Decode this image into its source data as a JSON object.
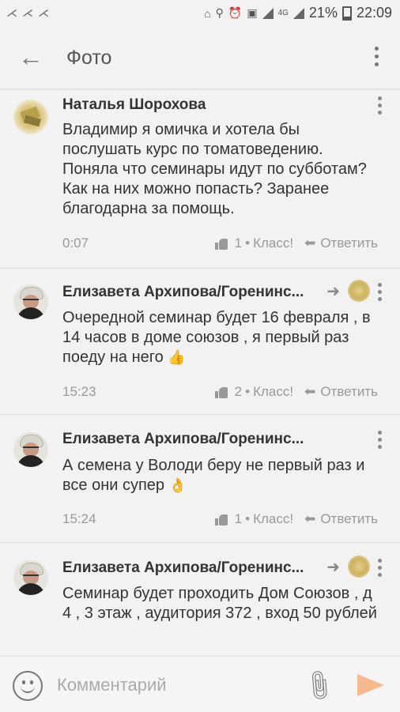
{
  "status_bar": {
    "battery": "21%",
    "time": "22:09",
    "network": "4G"
  },
  "app_bar": {
    "title": "Фото"
  },
  "comments": [
    {
      "author": "Наталья Шорохова",
      "text": "Владимир я омичка и хотела бы послушать курс по томатоведению. Поняла что семинары идут по субботам? Как на них можно попасть? Заранее благодарна за помощь.",
      "time": "0:07",
      "likes": "1",
      "like_label": "Класс!",
      "reply_label": "Ответить",
      "is_reply": false
    },
    {
      "author": "Елизавета Архипова/Горенинс...",
      "text": "Очередной семинар будет 16 февраля , в 14 часов в доме союзов , я первый раз поеду на него",
      "emoji": "👍",
      "time": "15:23",
      "likes": "2",
      "like_label": "Класс!",
      "reply_label": "Ответить",
      "is_reply": true
    },
    {
      "author": "Елизавета Архипова/Горенинс...",
      "text": "А семена у Володи беру не первый раз и все они супер",
      "emoji": "👌",
      "time": "15:24",
      "likes": "1",
      "like_label": "Класс!",
      "reply_label": "Ответить",
      "is_reply": false
    },
    {
      "author": "Елизавета Архипова/Горенинс...",
      "text": "Семинар будет проходить Дом Союзов , д 4 , 3 этаж , аудитория 372 , вход 50 рублей",
      "is_reply": true
    }
  ],
  "input_bar": {
    "placeholder": "Комментарий"
  },
  "colors": {
    "background": "#f2f2f2",
    "send_button": "#f7b98e",
    "meta_text": "#999999"
  }
}
